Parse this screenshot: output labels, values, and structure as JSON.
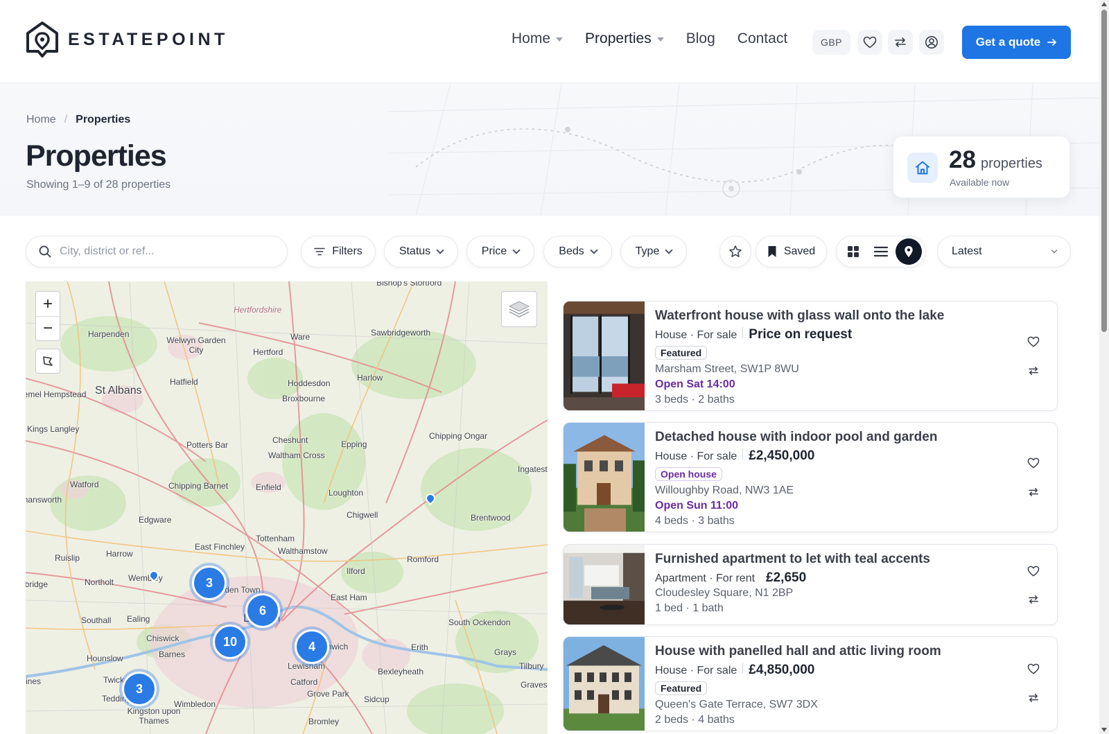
{
  "brand": {
    "name": "ESTATEPOINT"
  },
  "nav": {
    "items": [
      {
        "label": "Home",
        "has_caret": true
      },
      {
        "label": "Properties",
        "has_caret": true
      },
      {
        "label": "Blog",
        "has_caret": false
      },
      {
        "label": "Contact",
        "has_caret": false
      }
    ],
    "currency": "GBP",
    "icons": [
      "heart-icon",
      "compare-icon",
      "account-icon"
    ],
    "cta_label": "Get a quote",
    "cta_color": "#1d76e3"
  },
  "breadcrumb": {
    "home": "Home",
    "separator": "/",
    "current": "Properties"
  },
  "page": {
    "title": "Properties",
    "subtitle": "Showing 1–9 of 28 properties"
  },
  "stats": {
    "count": "28",
    "word": "properties",
    "sub": "Available now"
  },
  "filters": {
    "search_placeholder": "City, district or ref...",
    "filters_label": "Filters",
    "status_label": "Status",
    "price_label": "Price",
    "beds_label": "Beds",
    "type_label": "Type",
    "saved_label": "Saved",
    "views": [
      "grid-view",
      "list-view",
      "map-view"
    ],
    "active_view": "map-view",
    "sort_label": "Latest"
  },
  "map": {
    "labels": [
      "Bishop's Stortford",
      "Hertfordshire",
      "Harpenden",
      "Welwyn Garden City",
      "Ware",
      "Sawbridgeworth",
      "Hertford",
      "Hatfield",
      "Harlow",
      "St Albans",
      "Hemel Hempstead",
      "Hoddesdon",
      "Broxbourne",
      "Kings Langley",
      "Potters Bar",
      "Cheshunt",
      "Waltham Cross",
      "Epping",
      "Chipping Ongar",
      "Watford",
      "Chipping Barnet",
      "Enfield",
      "Loughton",
      "Ingatestone",
      "Rickmansworth",
      "Edgware",
      "Chigwell",
      "Brentwood",
      "Tottenham",
      "Walthamstow",
      "East Finchley",
      "Ruislip",
      "Harrow",
      "Romford",
      "Wembley",
      "Camden Town",
      "Ilford",
      "Uxbridge",
      "Northolt",
      "East Ham",
      "London",
      "Southall",
      "Ealing",
      "South Ockendon",
      "Chiswick",
      "Greenwich",
      "Erith",
      "Grays",
      "Hounslow",
      "Barnes",
      "Lewisham",
      "Bexleyheath",
      "Tilbury",
      "Twickenham",
      "Catford",
      "Gravesend",
      "Teddington",
      "Grove Park",
      "Sidcup",
      "Kingston upon Thames",
      "Wimbledon",
      "Bromley",
      "Staines"
    ],
    "clusters": [
      "3",
      "6",
      "10",
      "4",
      "3"
    ],
    "zoom_in": "+",
    "zoom_out": "−"
  },
  "listings": [
    {
      "title": "Waterfront house with glass wall onto the lake",
      "type": "House · For sale",
      "price": "Price on request",
      "badge": "Featured",
      "address": "Marsham Street, SW1P 8WU",
      "open": "Open Sat 14:00",
      "specs": "3 beds · 2 baths"
    },
    {
      "title": "Detached house with indoor pool and garden",
      "type": "House · For sale",
      "price": "£2,450,000",
      "badge": "Open house",
      "address": "Willoughby Road, NW3 1AE",
      "open": "Open Sun 11:00",
      "specs": "4 beds · 3 baths"
    },
    {
      "title": "Furnished apartment to let with teal accents",
      "type": "Apartment · For rent",
      "price": "£2,650",
      "address": "Cloudesley Square, N1 2BP",
      "specs": "1 bed · 1 bath"
    },
    {
      "title": "House with panelled hall and attic living room",
      "type": "House · For sale",
      "price": "£4,850,000",
      "badge": "Featured",
      "address": "Queen's Gate Terrace, SW7 3DX",
      "specs": "2 beds · 4 baths"
    }
  ]
}
